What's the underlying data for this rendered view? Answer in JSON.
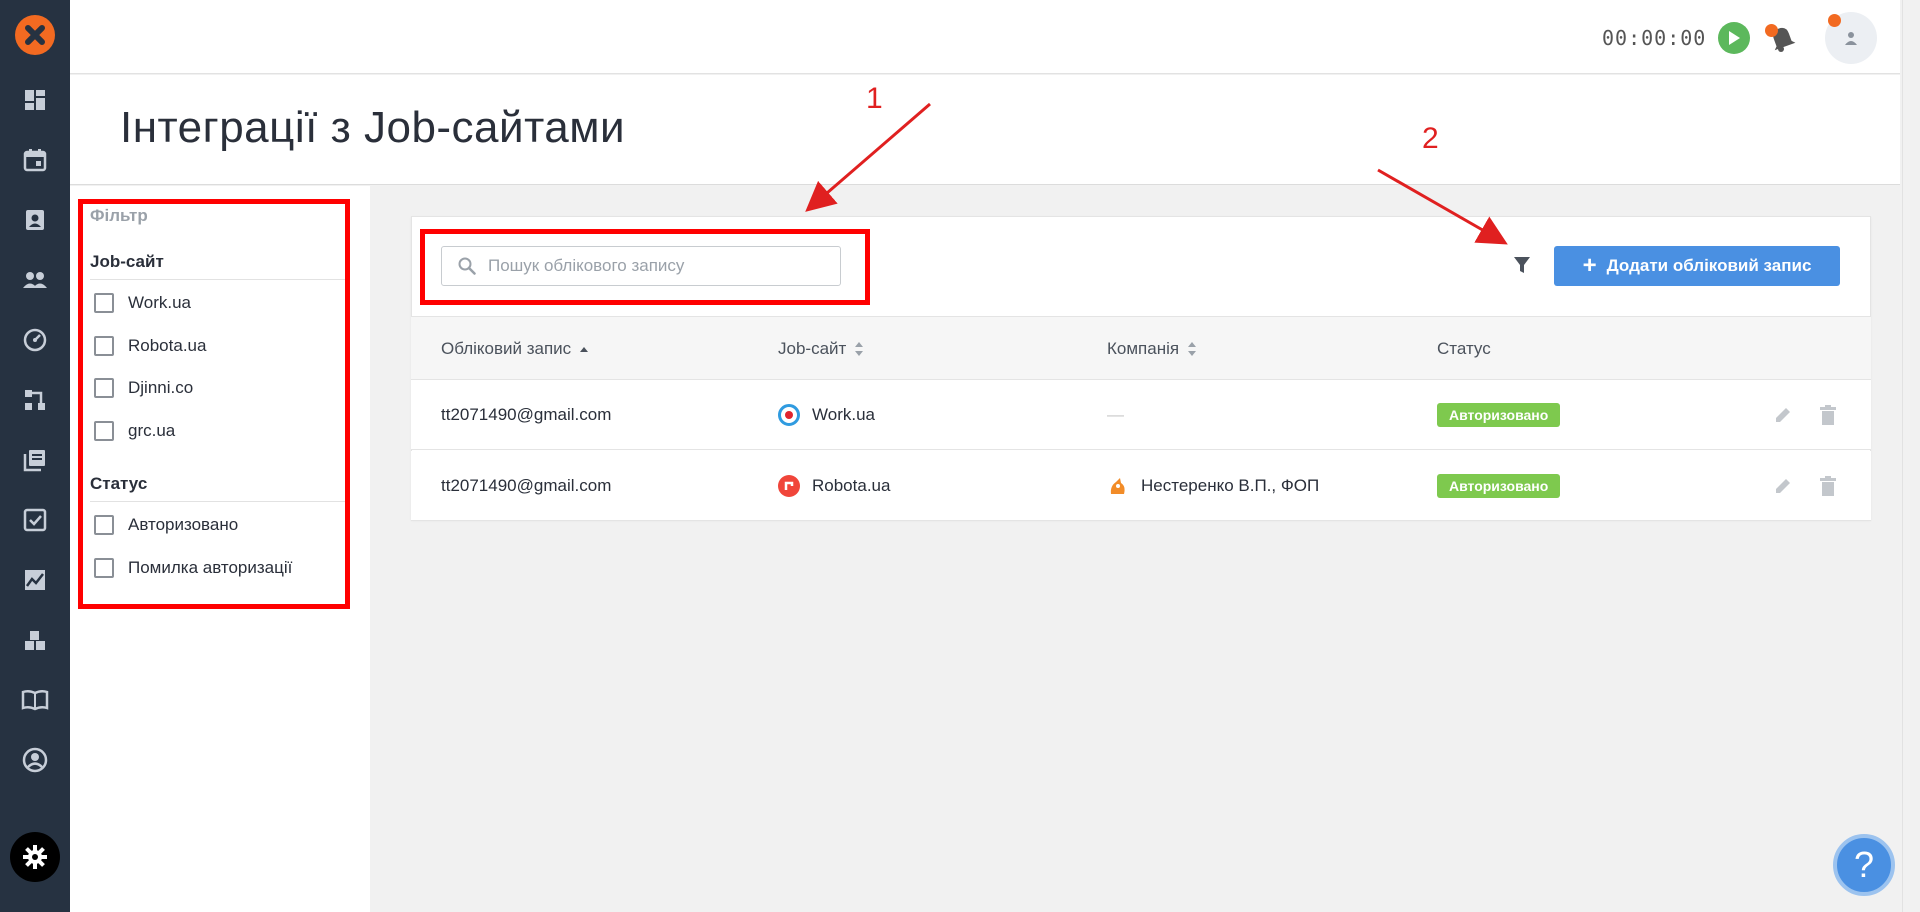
{
  "header": {
    "timer": "00:00:00"
  },
  "page": {
    "title": "Інтеграції з Job-сайтами"
  },
  "filter": {
    "title": "Фільтр",
    "job_site_title": "Job-сайт",
    "job_sites": [
      "Work.ua",
      "Robota.ua",
      "Djinni.co",
      "grc.ua"
    ],
    "status_title": "Статус",
    "statuses": [
      "Авторизовано",
      "Помилка авторизації"
    ]
  },
  "toolbar": {
    "search_placeholder": "Пошук облікового запису",
    "add_label": "Додати обліковий запис"
  },
  "table": {
    "columns": [
      "Обліковий запис",
      "Job-сайт",
      "Компанія",
      "Статус"
    ],
    "rows": [
      {
        "account": "tt2071490@gmail.com",
        "site": "Work.ua",
        "company": "—",
        "status": "Авторизовано"
      },
      {
        "account": "tt2071490@gmail.com",
        "site": "Robota.ua",
        "company": "Нестеренко В.П., ФОП",
        "status": "Авторизовано"
      }
    ]
  },
  "annotations": {
    "one": "1",
    "two": "2"
  },
  "help": {
    "label": "?"
  },
  "colors": {
    "sidebar": "#263241",
    "accent": "#4a90e2",
    "brand": "#f26a21",
    "status_ok": "#7ec94e",
    "annotation": "#ff0000"
  }
}
